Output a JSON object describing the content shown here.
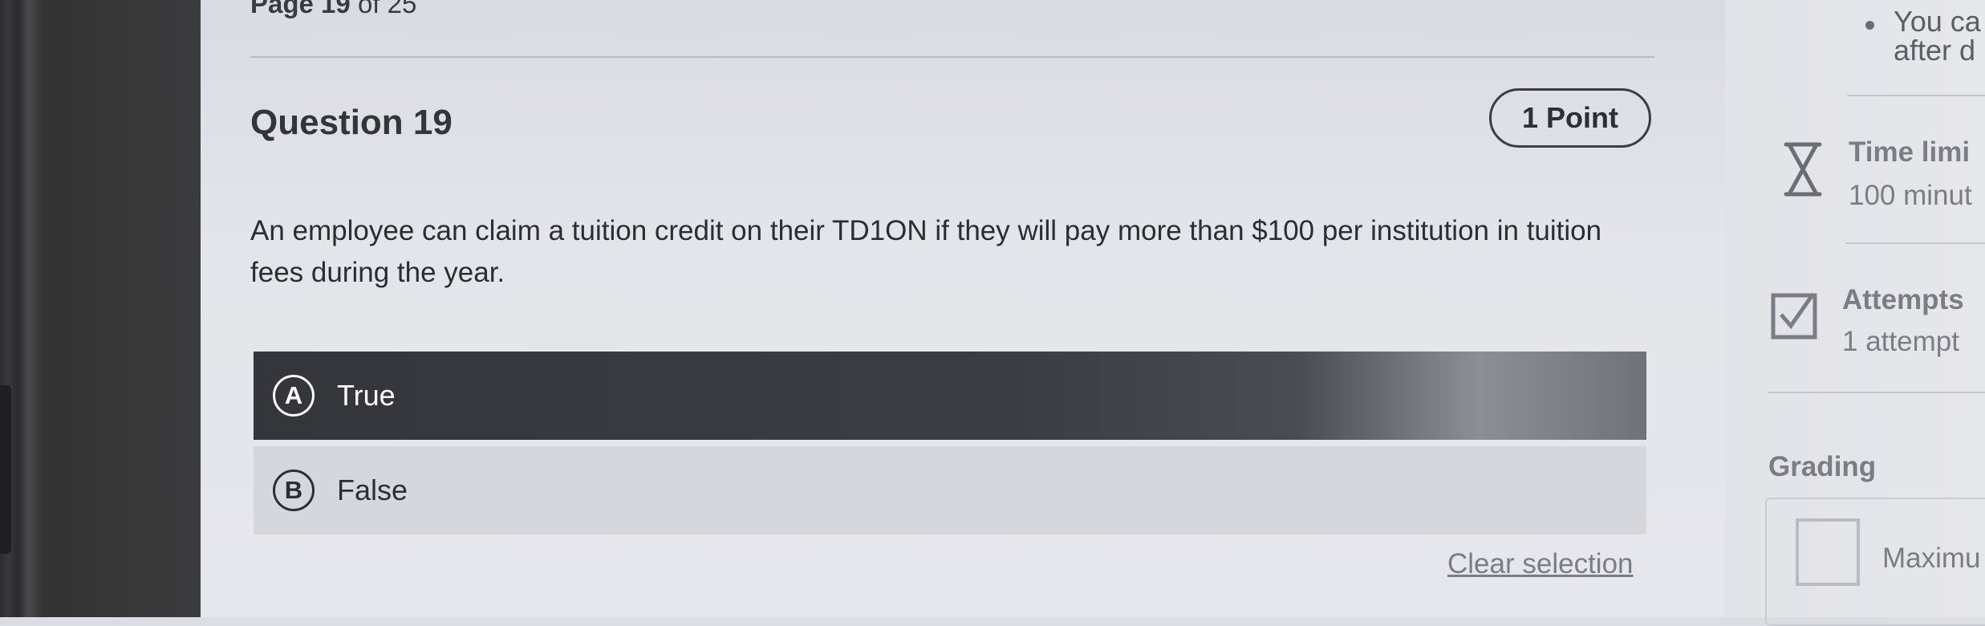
{
  "page": {
    "prefix": "Page",
    "current": "19",
    "separator": "of",
    "total": "25"
  },
  "question": {
    "title": "Question 19",
    "points": "1 Point",
    "text": "An employee can claim a tuition credit on their TD1ON if they will pay more than $100 per institution in tuition fees during the year.",
    "options": [
      {
        "letter": "A",
        "label": "True",
        "selected": true
      },
      {
        "letter": "B",
        "label": "False",
        "selected": false
      }
    ],
    "clear_label": "Clear selection"
  },
  "sidebar": {
    "note_line1": "You ca",
    "note_line2": "after d",
    "time_limit": {
      "icon": "hourglass-icon",
      "heading": "Time limi",
      "value": "100 minut"
    },
    "attempts": {
      "icon": "checkbox-icon",
      "heading": "Attempts",
      "value": "1 attempt"
    },
    "grading": {
      "heading": "Grading",
      "max_label": "Maximu"
    }
  },
  "colors": {
    "selected_bg": "#34363c",
    "text": "#2c2d32",
    "muted": "#7a7d85"
  }
}
